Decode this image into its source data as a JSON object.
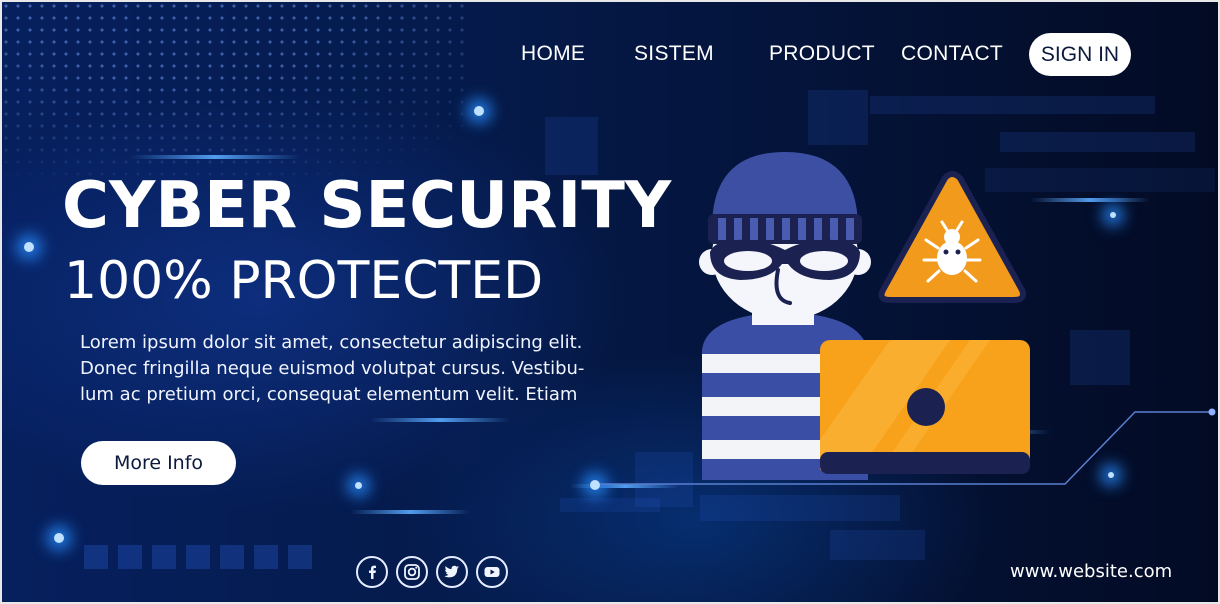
{
  "nav": {
    "items": [
      "HOME",
      "SISTEM",
      "PRODUCT",
      "CONTACT"
    ],
    "signin_label": "SIGN IN"
  },
  "hero": {
    "title": "CYBER SECURITY",
    "subtitle": "100% PROTECTED",
    "body_lines": [
      "Lorem ipsum dolor sit amet, consectetur adipiscing elit.",
      "Donec fringilla neque euismod volutpat cursus. Vestibu-",
      "lum ac pretium orci, consequat elementum velit. Etiam"
    ],
    "cta_label": "More Info"
  },
  "illustration": {
    "subject": "hacker-with-laptop",
    "warning_icon": "bug-warning-icon",
    "colors": {
      "hat": "#3d4fa3",
      "laptop": "#f7a21a",
      "warning": "#f19a1c",
      "outline": "#1a2148"
    }
  },
  "social": {
    "icons": [
      "facebook-icon",
      "instagram-icon",
      "twitter-icon",
      "youtube-icon"
    ]
  },
  "footer": {
    "website": "www.website.com"
  },
  "theme": {
    "background": "#04102e",
    "accent_glow": "#2a8cff",
    "button_bg": "#ffffff",
    "button_text": "#0b1a3c"
  }
}
